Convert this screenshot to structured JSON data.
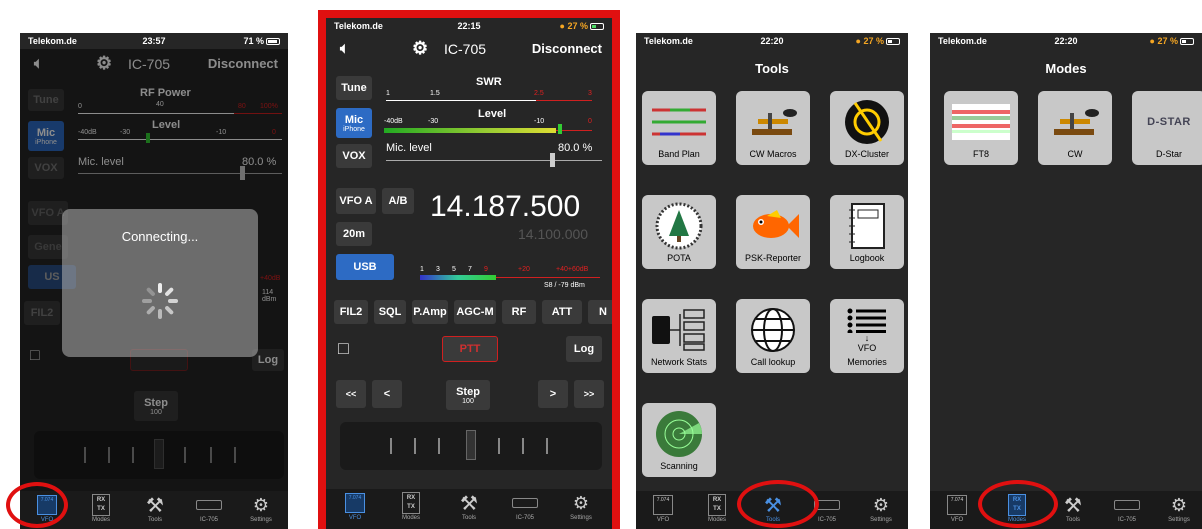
{
  "panel1": {
    "status": {
      "carrier": "Telekom.de",
      "time": "23:57",
      "battery": "71 %"
    },
    "header": {
      "radio": "IC-705",
      "disconnect": "Disconnect"
    },
    "buttons": {
      "tune": "Tune",
      "mic": "Mic",
      "mic_sub": "iPhone",
      "vox": "VOX",
      "vfoa": "VFO A",
      "gen": "Gene",
      "usb": "US",
      "fil2": "FIL2",
      "step": "Step",
      "step_val": "100",
      "log": "Log"
    },
    "meters": {
      "rf_power": "RF Power",
      "level": "Level",
      "mic_level": "Mic. level",
      "mic_value": "80.0 %",
      "rf_scale": [
        "0",
        "40",
        "80",
        "100%"
      ],
      "level_scale": [
        "-40dB",
        "-30",
        "-10",
        "0"
      ],
      "side_scale": [
        "+40dB",
        "114 dBm"
      ]
    },
    "modal": {
      "text": "Connecting..."
    }
  },
  "panel2": {
    "status": {
      "carrier": "Telekom.de",
      "time": "22:15",
      "battery": "27 %"
    },
    "header": {
      "radio": "IC-705",
      "disconnect": "Disconnect"
    },
    "buttons": {
      "tune": "Tune",
      "mic": "Mic",
      "mic_sub": "iPhone",
      "vox": "VOX",
      "vfoa": "VFO A",
      "ab": "A/B",
      "band": "20m",
      "mode": "USB",
      "fil2": "FIL2",
      "sql": "SQL",
      "pamp": "P.Amp",
      "agc": "AGC-M",
      "rf": "RF",
      "att": "ATT",
      "n": "N",
      "ptt": "PTT",
      "log": "Log",
      "fast_back": "<<",
      "back": "<",
      "step": "Step",
      "step_val": "100",
      "fwd": ">",
      "fast_fwd": ">>"
    },
    "meters": {
      "swr": "SWR",
      "swr_scale": [
        "1",
        "1.5",
        "2.5",
        "3"
      ],
      "level": "Level",
      "level_scale": [
        "-40dB",
        "-30",
        "-10",
        "0"
      ],
      "mic_level": "Mic. level",
      "mic_value": "80.0 %",
      "s_scale": [
        "1",
        "3",
        "5",
        "7",
        "9",
        "+20",
        "+40+60dB"
      ],
      "s_reading": "S8 / -79 dBm"
    },
    "freq": {
      "main": "14.187.500",
      "sub": "14.100.000"
    }
  },
  "panel3": {
    "status": {
      "carrier": "Telekom.de",
      "time": "22:20",
      "battery": "27 %"
    },
    "title": "Tools",
    "tiles": [
      "Band Plan",
      "CW Macros",
      "DX-Cluster",
      "POTA",
      "PSK-Reporter",
      "Logbook",
      "Network Stats",
      "Call lookup",
      "Memories",
      "Scanning"
    ],
    "memories_vfo": "VFO"
  },
  "panel4": {
    "status": {
      "carrier": "Telekom.de",
      "time": "22:20",
      "battery": "27 %"
    },
    "title": "Modes",
    "tiles": [
      "FT8",
      "CW",
      "D-Star"
    ],
    "dstar_logo": "D-STAR"
  },
  "tabbar": {
    "vfo": "VFO",
    "vfo_freq": "7.074",
    "modes": "Modes",
    "rx": "RX",
    "tx": "TX",
    "tools": "Tools",
    "rig": "IC-705",
    "settings": "Settings"
  },
  "colors": {
    "highlight": "#e01010",
    "active_tab": "#4a90e2",
    "mode_blue": "#2d6bc4"
  }
}
